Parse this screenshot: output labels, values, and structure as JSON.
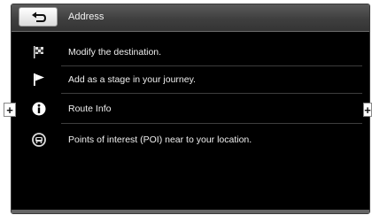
{
  "header": {
    "title": "Address",
    "back_icon": "back-arrow-icon"
  },
  "menu": {
    "items": [
      {
        "label": "Modify the destination.",
        "icon": "checkered-flag-icon"
      },
      {
        "label": "Add as a stage in your journey.",
        "icon": "flag-icon"
      },
      {
        "label": "Route Info",
        "icon": "info-icon"
      },
      {
        "label": "Points of interest (POI) near to your location.",
        "icon": "poi-icon"
      }
    ]
  },
  "side_controls": {
    "left_plus": "+",
    "right_plus": "+"
  },
  "colors": {
    "background": "#000000",
    "header": "#4a4a4a",
    "text": "#f0f0f0"
  }
}
